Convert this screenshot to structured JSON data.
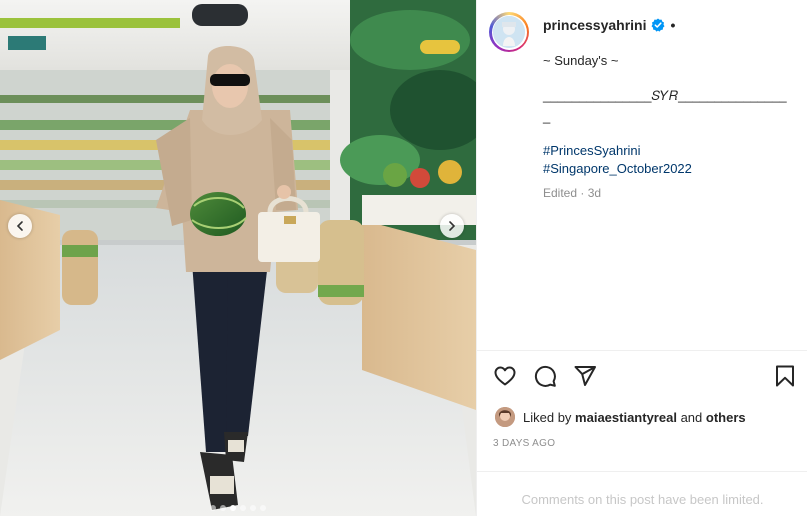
{
  "post": {
    "username": "princessyahrini",
    "separator": "•",
    "caption_line1": "~ Sunday's ~",
    "caption_line2": "_______________𝑆𝑌𝑅_______________",
    "caption_line3": "_",
    "hashtags": [
      "#PrincesSyahrini",
      "#Singapore_October2022"
    ],
    "edited": "Edited · 3d"
  },
  "likes": {
    "prefix": "Liked by ",
    "user": "maiaestiantyreal",
    "and": " and ",
    "others": "others"
  },
  "time_ago": "3 DAYS AGO",
  "comments_notice": "Comments on this post have been limited.",
  "media": {
    "dots_total": 6,
    "dots_active_index": 2
  },
  "colors": {
    "link": "#00376b",
    "verified_badge": "#0095f6",
    "muted": "#8e8e8e"
  },
  "icons": {
    "like": "heart-icon",
    "comment": "comment-icon",
    "share": "paper-plane-icon",
    "save": "bookmark-icon",
    "verified": "verified-badge-icon",
    "prev": "chevron-left-icon",
    "next": "chevron-right-icon"
  }
}
